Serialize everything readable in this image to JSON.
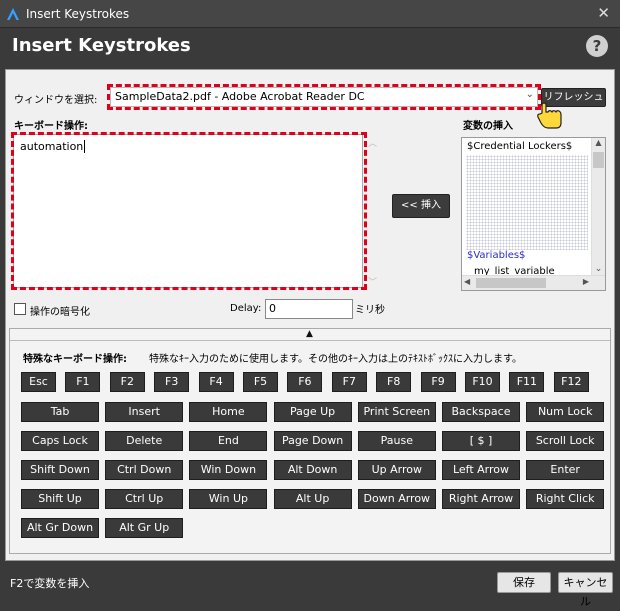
{
  "window": {
    "title": "Insert Keystrokes",
    "close_icon": "close-icon"
  },
  "header": {
    "title": "Insert Keystrokes",
    "help_glyph": "?"
  },
  "window_select": {
    "label": "ウィンドウを選択:",
    "value": "SampleData2.pdf - Adobe Acrobat Reader DC",
    "refresh_label": "リフレッシュ"
  },
  "keyboard": {
    "label": "キーボード操作:",
    "value": "automation"
  },
  "insert_button": {
    "label": "<< 挿入"
  },
  "variables": {
    "label": "変数の挿入",
    "items": [
      "$Credential Lockers$",
      "$Variables$",
      "my_list_variable"
    ],
    "colors": {
      "credential": "#000000",
      "variables": "#2a2acc"
    }
  },
  "encrypt": {
    "label": "操作の暗号化"
  },
  "delay": {
    "label": "Delay:",
    "value": "0",
    "unit": "ミリ秒"
  },
  "special": {
    "title": "特殊なキーボード操作:",
    "description": "特殊なｷｰ入力のために使用します。その他のｷｰ入力は上のﾃｷｽﾄﾎﾞｯｸｽに入力します。",
    "rows": [
      [
        "Esc",
        "F1",
        "F2",
        "F3",
        "F4",
        "F5",
        "F6",
        "F7",
        "F8",
        "F9",
        "F10",
        "F11",
        "F12"
      ],
      [
        "Tab",
        "Insert",
        "Home",
        "Page Up",
        "Print Screen",
        "Backspace",
        "Num Lock"
      ],
      [
        "Caps Lock",
        "Delete",
        "End",
        "Page Down",
        "Pause",
        "[      $      ]",
        "Scroll Lock"
      ],
      [
        "Shift Down",
        "Ctrl Down",
        "Win Down",
        "Alt Down",
        "Up Arrow",
        "Left Arrow",
        "Enter"
      ],
      [
        "Shift Up",
        "Ctrl Up",
        "Win Up",
        "Alt Up",
        "Down Arrow",
        "Right Arrow",
        "Right Click"
      ],
      [
        "Alt Gr Down",
        "Alt Gr Up"
      ]
    ]
  },
  "footer": {
    "hint": "F2で変数を挿入",
    "save_label": "保存",
    "cancel_label": "キャンセル"
  },
  "accent": "#e0001b"
}
